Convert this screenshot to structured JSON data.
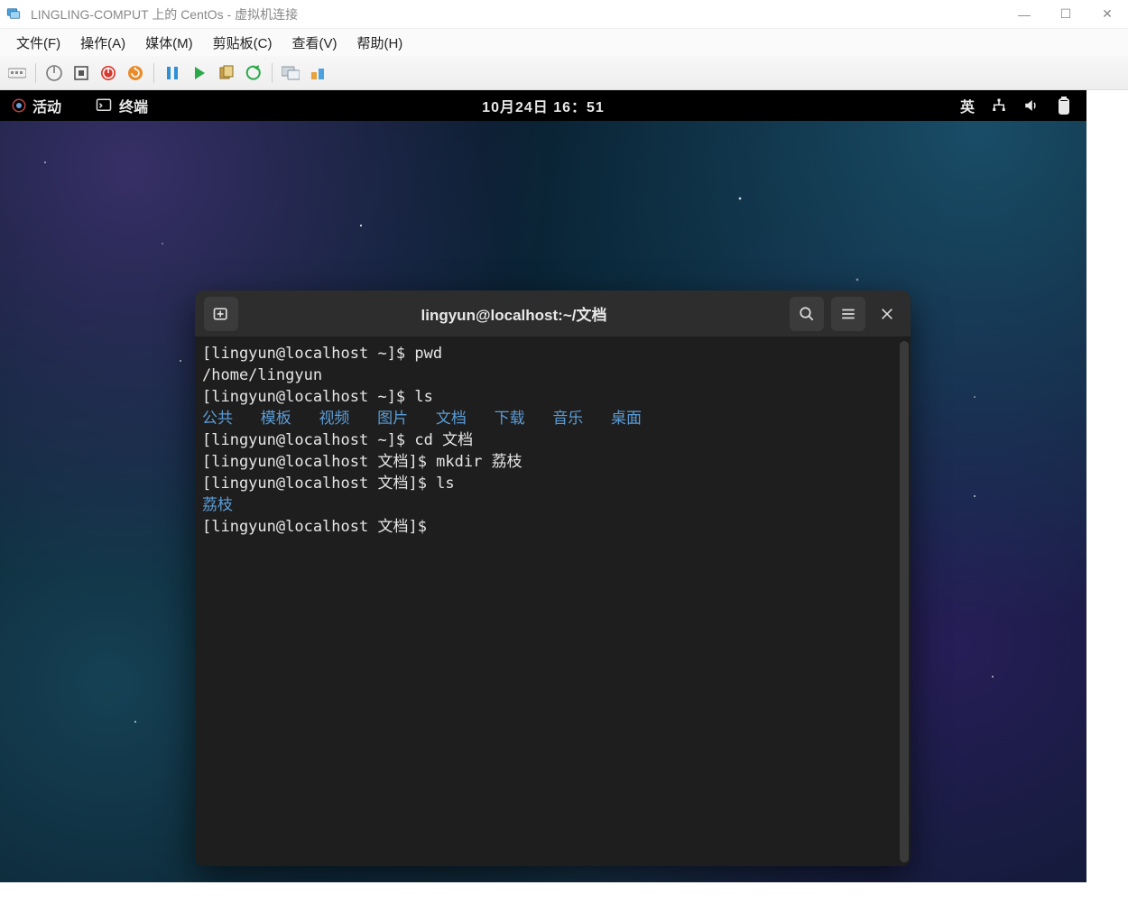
{
  "host": {
    "title": "LINGLING-COMPUT 上的 CentOs - 虚拟机连接",
    "menu": {
      "file": "文件(F)",
      "action": "操作(A)",
      "media": "媒体(M)",
      "clipboard": "剪贴板(C)",
      "view": "查看(V)",
      "help": "帮助(H)"
    },
    "window_controls": {
      "minimize": "—",
      "maximize": "☐",
      "close": "✕"
    }
  },
  "gnome": {
    "activities": "活动",
    "app_name": "终端",
    "clock": "10月24日 16：51",
    "input_method": "英"
  },
  "terminal": {
    "title": "lingyun@localhost:~/文档",
    "lines": {
      "l1_prompt": "[lingyun@localhost ~]$ ",
      "l1_cmd": "pwd",
      "l2": "/home/lingyun",
      "l3_prompt": "[lingyun@localhost ~]$ ",
      "l3_cmd": "ls",
      "l4_dirs": {
        "a": "公共",
        "b": "模板",
        "c": "视频",
        "d": "图片",
        "e": "文档",
        "f": "下载",
        "g": "音乐",
        "h": "桌面"
      },
      "l5_prompt": "[lingyun@localhost ~]$ ",
      "l5_cmd": "cd 文档",
      "l6_prompt": "[lingyun@localhost 文档]$ ",
      "l6_cmd": "mkdir 荔枝",
      "l7_prompt": "[lingyun@localhost 文档]$ ",
      "l7_cmd": "ls",
      "l8_dir": "荔枝",
      "l9_prompt": "[lingyun@localhost 文档]$ "
    }
  }
}
